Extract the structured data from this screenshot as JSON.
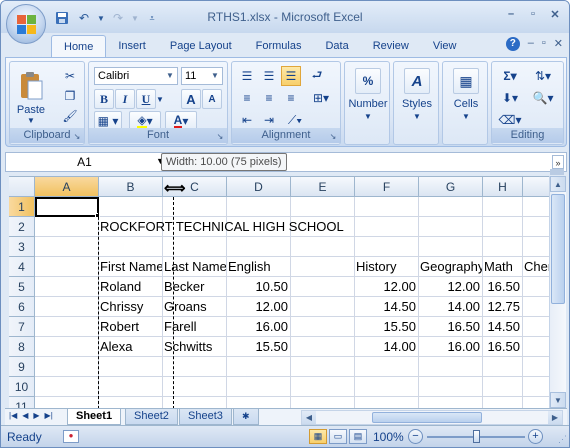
{
  "window": {
    "title": "RTHS1.xlsx - Microsoft Excel"
  },
  "qat": {
    "save_icon": "save-icon",
    "undo_icon": "undo-icon",
    "redo_icon": "redo-icon"
  },
  "ribbon_tabs": [
    "Home",
    "Insert",
    "Page Layout",
    "Formulas",
    "Data",
    "Review",
    "View"
  ],
  "active_tab": "Home",
  "ribbon": {
    "clipboard": {
      "label": "Clipboard",
      "paste": "Paste"
    },
    "font": {
      "label": "Font",
      "name": "Calibri",
      "size": "11",
      "bold": "B",
      "italic": "I",
      "underline": "U",
      "grow": "A",
      "shrink": "A"
    },
    "alignment": {
      "label": "Alignment"
    },
    "number": {
      "label": "Number",
      "percent": "%"
    },
    "styles": {
      "label": "Styles"
    },
    "cells": {
      "label": "Cells"
    },
    "editing": {
      "label": "Editing"
    }
  },
  "formula_bar": {
    "name_box": "A1",
    "tooltip": "Width: 10.00 (75 pixels)",
    "expand": "»"
  },
  "grid": {
    "columns": [
      "A",
      "B",
      "C",
      "D",
      "E",
      "F",
      "G",
      "H"
    ],
    "selected_column": "A",
    "rows": [
      "1",
      "2",
      "3",
      "4",
      "5",
      "6",
      "7",
      "8",
      "9",
      "10",
      "11"
    ],
    "selected_row": "1",
    "title": "ROCKFORT TECHNICAL HIGH SCHOOL",
    "headers": [
      "First Name",
      "Last Name",
      "English",
      "",
      "History",
      "Geography",
      "Math",
      "Chemistry"
    ],
    "records": [
      {
        "first": "Roland",
        "last": "Becker",
        "english": "10.50",
        "history": "12.00",
        "geography": "12.00",
        "math": "16.50"
      },
      {
        "first": "Chrissy",
        "last": "Groans",
        "english": "12.00",
        "history": "14.50",
        "geography": "14.00",
        "math": "12.75"
      },
      {
        "first": "Robert",
        "last": "Farell",
        "english": "16.00",
        "history": "15.50",
        "geography": "16.50",
        "math": "14.50"
      },
      {
        "first": "Alexa",
        "last": "Schwitts",
        "english": "15.50",
        "history": "14.00",
        "geography": "16.00",
        "math": "16.50"
      }
    ]
  },
  "sheet_tabs": [
    "Sheet1",
    "Sheet2",
    "Sheet3"
  ],
  "active_sheet": "Sheet1",
  "status": {
    "text": "Ready",
    "zoom": "100%",
    "zoom_fraction": 0.5
  }
}
